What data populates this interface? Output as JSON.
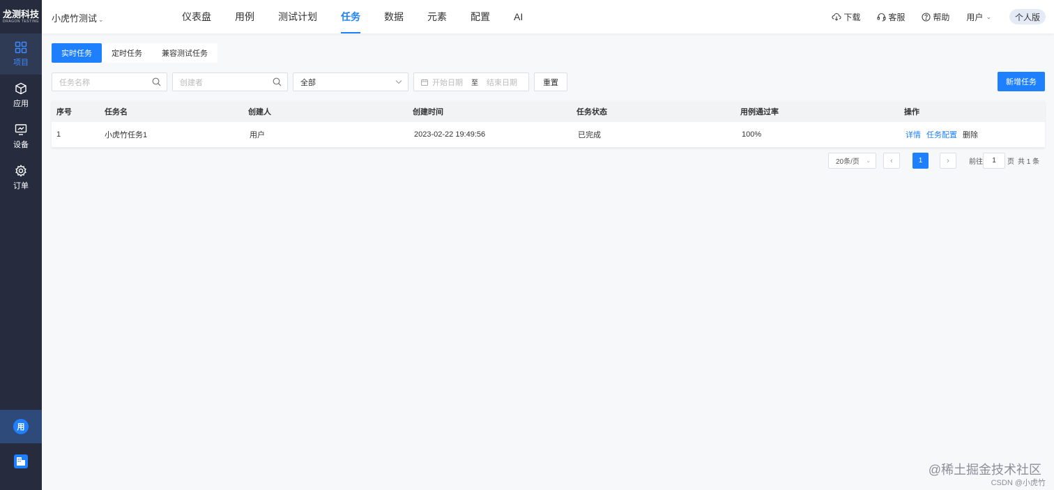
{
  "logo": {
    "zh": "龙测科技",
    "en": "DRAGON TESTING"
  },
  "sidebar": {
    "items": [
      {
        "label": "项目",
        "icon": "grid-icon",
        "active": true
      },
      {
        "label": "应用",
        "icon": "cube-icon",
        "active": false
      },
      {
        "label": "设备",
        "icon": "monitor-icon",
        "active": false
      },
      {
        "label": "订单",
        "icon": "gear-icon",
        "active": false
      }
    ],
    "user_initial": "用"
  },
  "header": {
    "project": "小虎竹测试",
    "nav": [
      "仪表盘",
      "用例",
      "测试计划",
      "任务",
      "数据",
      "元素",
      "配置",
      "AI"
    ],
    "active_nav": "任务",
    "tools": {
      "download": "下载",
      "service": "客服",
      "help": "帮助",
      "user": "用户"
    },
    "version": "个人版"
  },
  "tabs": [
    "实时任务",
    "定时任务",
    "兼容测试任务"
  ],
  "filters": {
    "task_name_placeholder": "任务名称",
    "creator_placeholder": "创建者",
    "status_value": "全部",
    "start_date_placeholder": "开始日期",
    "range_separator": "至",
    "end_date_placeholder": "结束日期",
    "reset_label": "重置",
    "add_label": "新增任务"
  },
  "table": {
    "headers": [
      "序号",
      "任务名",
      "创建人",
      "创建时间",
      "任务状态",
      "用例通过率",
      "操作"
    ],
    "rows": [
      {
        "index": "1",
        "name": "小虎竹任务1",
        "creator": "用户",
        "created": "2023-02-22 19:49:56",
        "status": "已完成",
        "pass_rate": "100%"
      }
    ],
    "ops": {
      "detail": "详情",
      "config": "任务配置",
      "delete": "删除"
    }
  },
  "pagination": {
    "page_size": "20条/页",
    "current": "1",
    "goto_prefix": "前往",
    "goto_value": "1",
    "goto_suffix": "页",
    "total": "共 1 条"
  },
  "watermark": {
    "main": "@稀土掘金技术社区",
    "sub": "CSDN @小虎竹"
  },
  "colors": {
    "primary": "#1e80ff",
    "sidebar": "#262c3d"
  }
}
